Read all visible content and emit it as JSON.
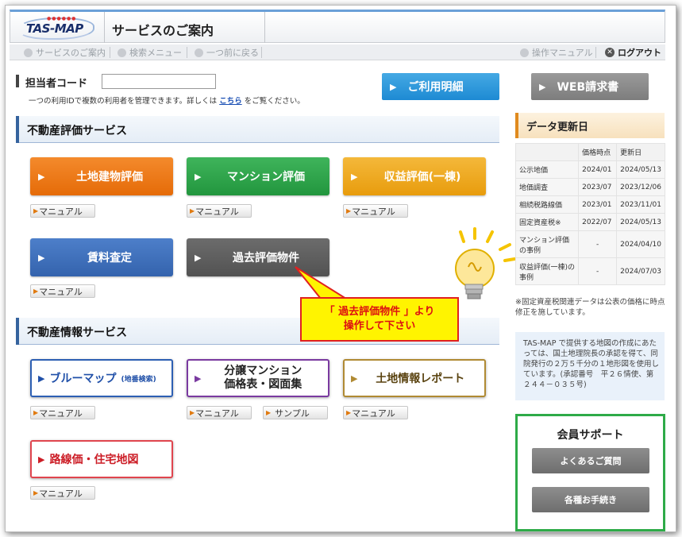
{
  "header": {
    "logo_text": "TAS-MAP",
    "page_title": "サービスのご案内"
  },
  "nav": {
    "items": [
      "サービスのご案内",
      "検索メニュー",
      "一つ前に戻る"
    ],
    "manual": "操作マニュアル",
    "logout": "ログアウト"
  },
  "code": {
    "label": "担当者コード",
    "value": "",
    "note_before": "一つの利用IDで複数の利用者を管理できます。詳しくは ",
    "note_link": "こちら",
    "note_after": " をご覧ください。"
  },
  "buttons": {
    "usage": "ご利用明細",
    "invoice": "WEB請求書"
  },
  "sections": {
    "valuation": "不動産評価サービス",
    "info": "不動産情報サービス"
  },
  "services": {
    "land": "土地建物評価",
    "mansion": "マンション評価",
    "income": "収益評価(一棟)",
    "rent": "賃料査定",
    "past": "過去評価物件",
    "blue_main": "ブルーマップ",
    "blue_sub": "(地番検索)",
    "bunjo_line1": "分譲マンション",
    "bunjo_line2": "価格表・図面集",
    "landinfo": "土地情報レポート",
    "route": "路線価・住宅地図"
  },
  "manual_label": "マニュアル",
  "sample_label": "サンプル",
  "callout": {
    "line1": "「 過去評価物件 」より",
    "line2": "操作して下さい"
  },
  "data_update": {
    "title": "データ更新日",
    "headers": [
      "",
      "価格時点",
      "更新日"
    ],
    "rows": [
      [
        "公示地価",
        "2024/01",
        "2024/05/13"
      ],
      [
        "地価調査",
        "2023/07",
        "2023/12/06"
      ],
      [
        "相続税路線価",
        "2023/01",
        "2023/11/01"
      ],
      [
        "固定資産税※",
        "2022/07",
        "2024/05/13"
      ],
      [
        "マンション評価の事例",
        "-",
        "2024/04/10"
      ],
      [
        "収益評価(一棟)の事例",
        "-",
        "2024/07/03"
      ]
    ],
    "note": "※固定資産税関連データは公表の価格に時点修正を施しています。"
  },
  "map_note": "TAS-MAP で提供する地図の作成にあたっては、国土地理院長の承認を得て、同院発行の２万５千分の１地形図を使用しています。(承認番号　平２６情使、第２４４－０３５号)",
  "support": {
    "title": "会員サポート",
    "faq": "よくあるご質問",
    "procedures": "各種お手続き"
  }
}
